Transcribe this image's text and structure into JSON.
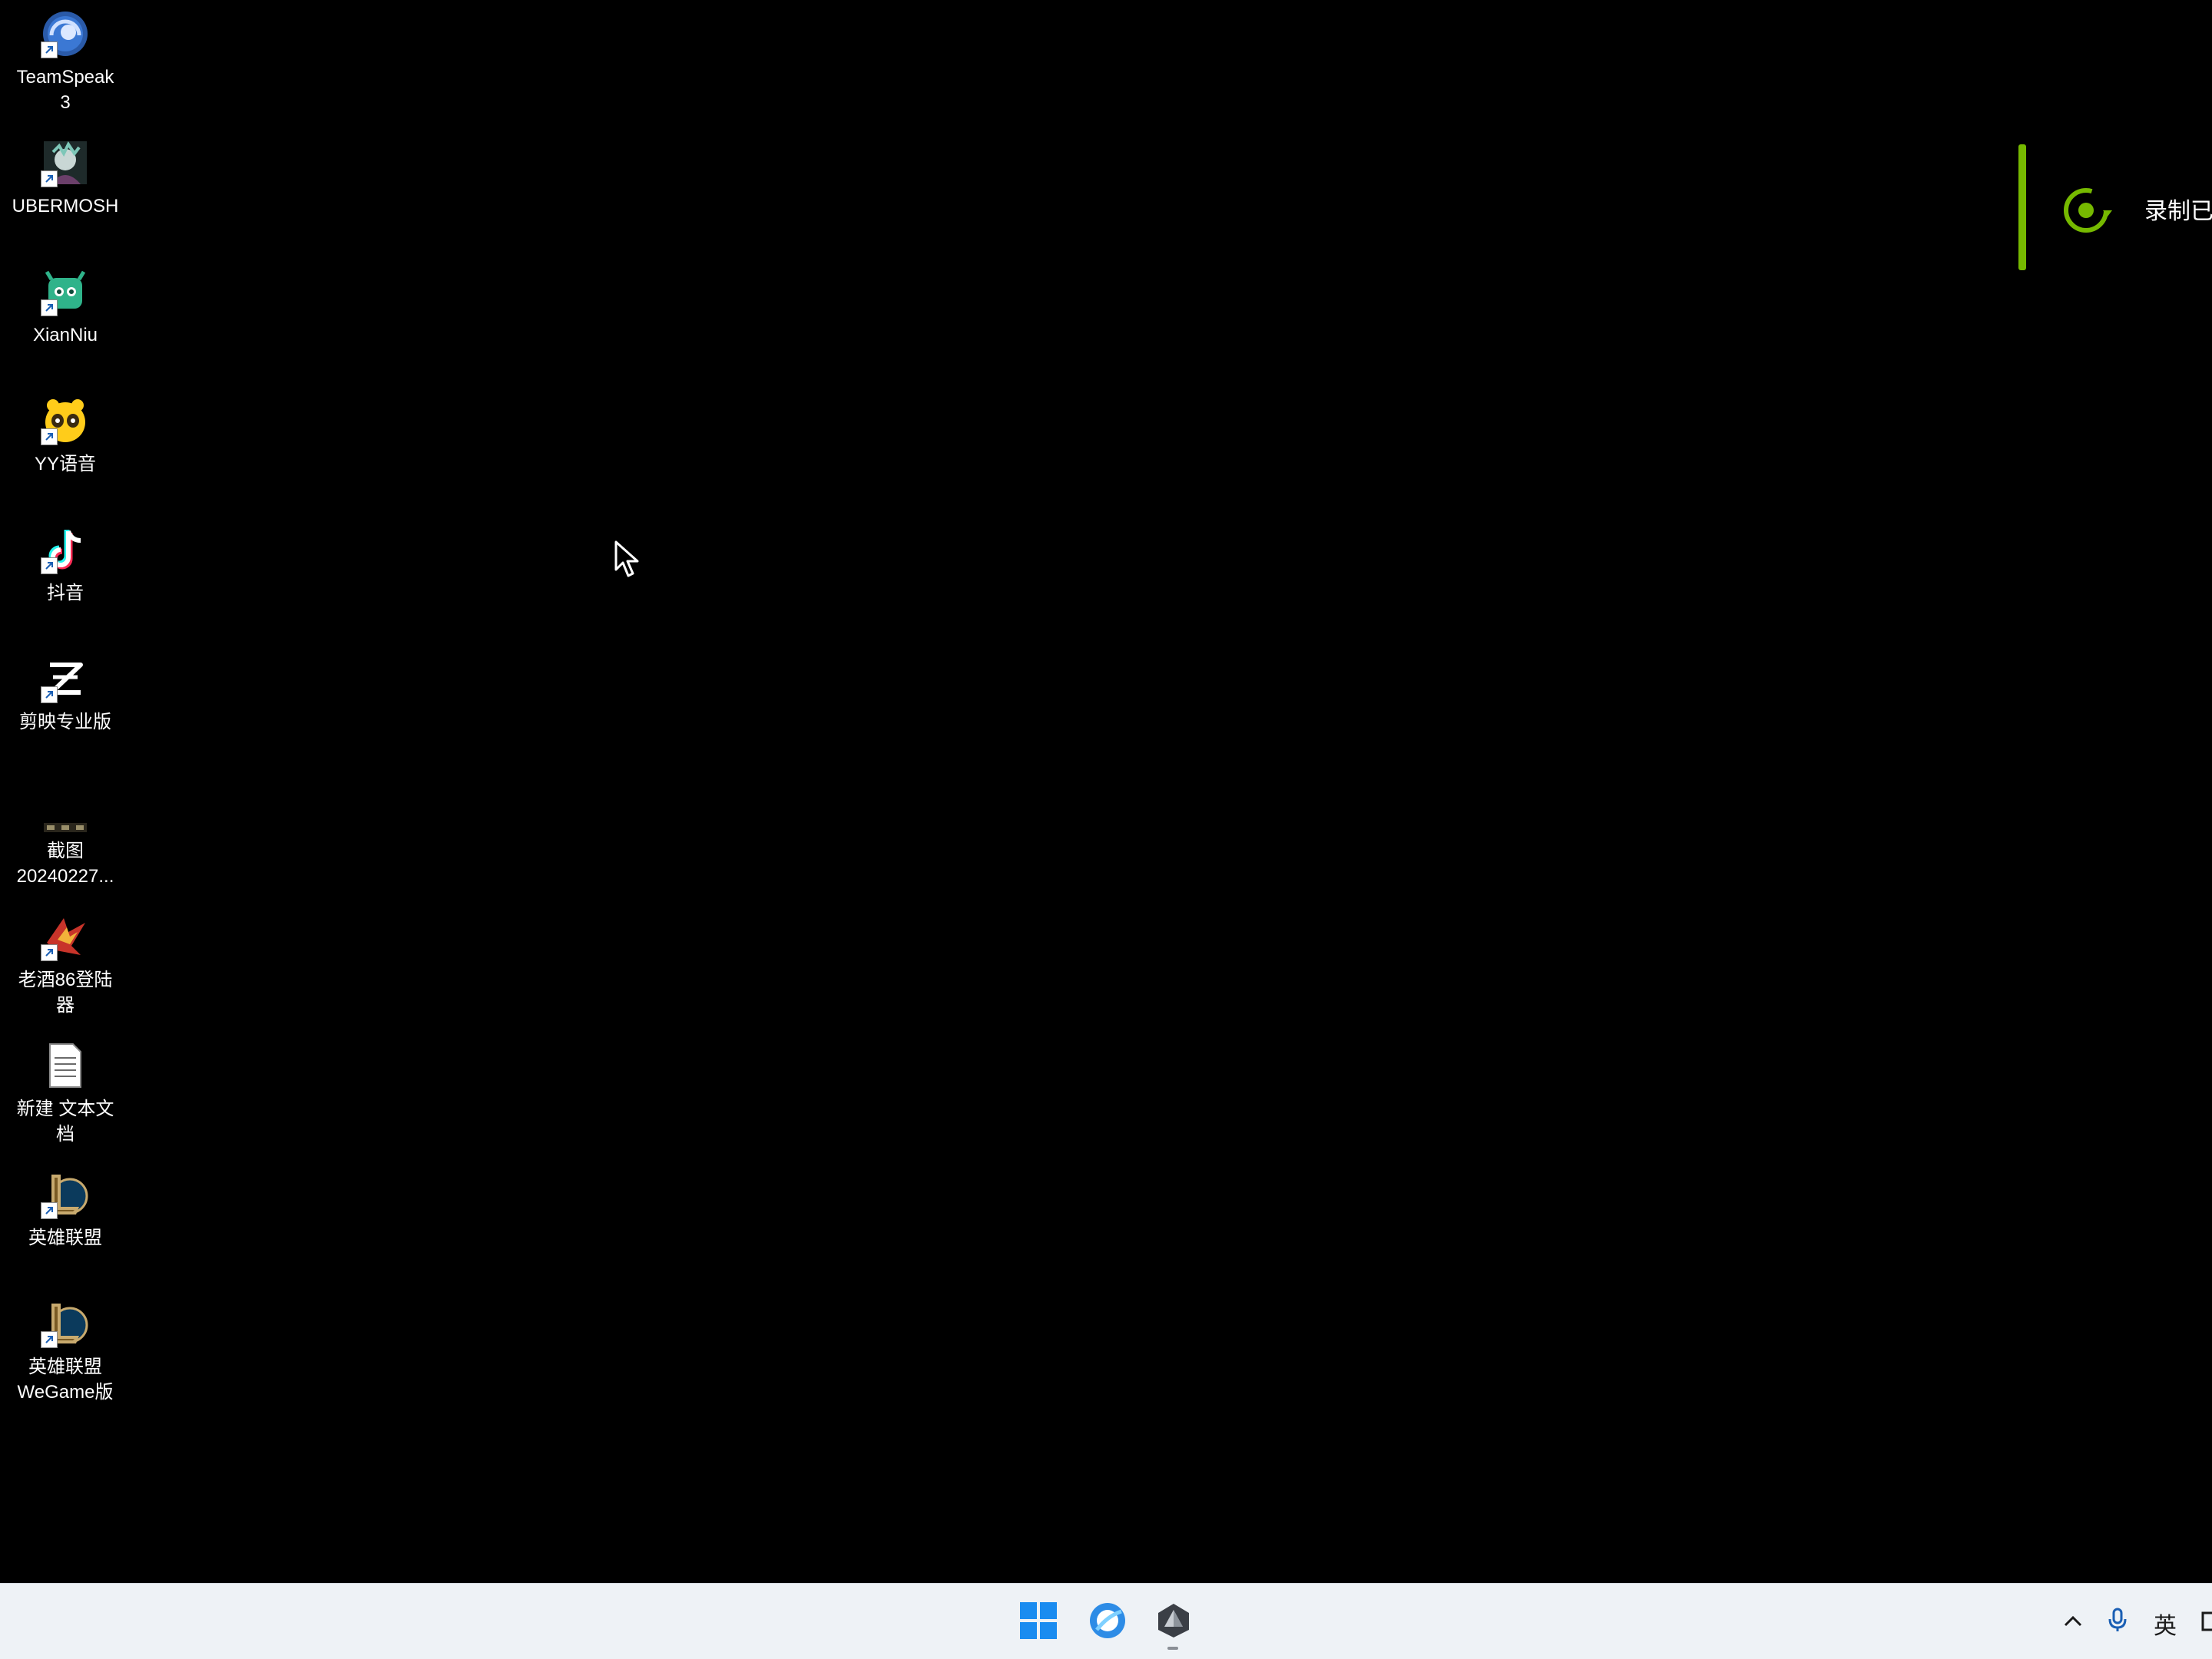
{
  "desktop": {
    "icons": [
      {
        "name": "TeamSpeak",
        "line1": "TeamSpeak",
        "line2": "3"
      },
      {
        "name": "UBERMOSH",
        "line1": "UBERMOSH",
        "line2": ""
      },
      {
        "name": "XianNiu",
        "line1": "XianNiu",
        "line2": ""
      },
      {
        "name": "YY语音",
        "line1": "YY语音",
        "line2": ""
      },
      {
        "name": "抖音",
        "line1": "抖音",
        "line2": ""
      },
      {
        "name": "剪映专业版",
        "line1": "剪映专业版",
        "line2": ""
      },
      {
        "name": "截图 20240227...",
        "line1": "截图",
        "line2": "20240227..."
      },
      {
        "name": "老酒86登陆器",
        "line1": "老酒86登陆",
        "line2": "器"
      },
      {
        "name": "新建 文本文档",
        "line1": "新建 文本文",
        "line2": "档"
      },
      {
        "name": "英雄联盟",
        "line1": "英雄联盟",
        "line2": ""
      },
      {
        "name": "英雄联盟 WeGame版",
        "line1": "英雄联盟",
        "line2": "WeGame版"
      }
    ]
  },
  "notification": {
    "text": "录制已",
    "accent_color": "#76b900"
  },
  "taskbar": {
    "items": [
      {
        "icon": "windows-start-icon"
      },
      {
        "icon": "qq-browser-icon"
      },
      {
        "icon": "app-icon"
      }
    ],
    "tray": {
      "ime_label": "英"
    }
  }
}
